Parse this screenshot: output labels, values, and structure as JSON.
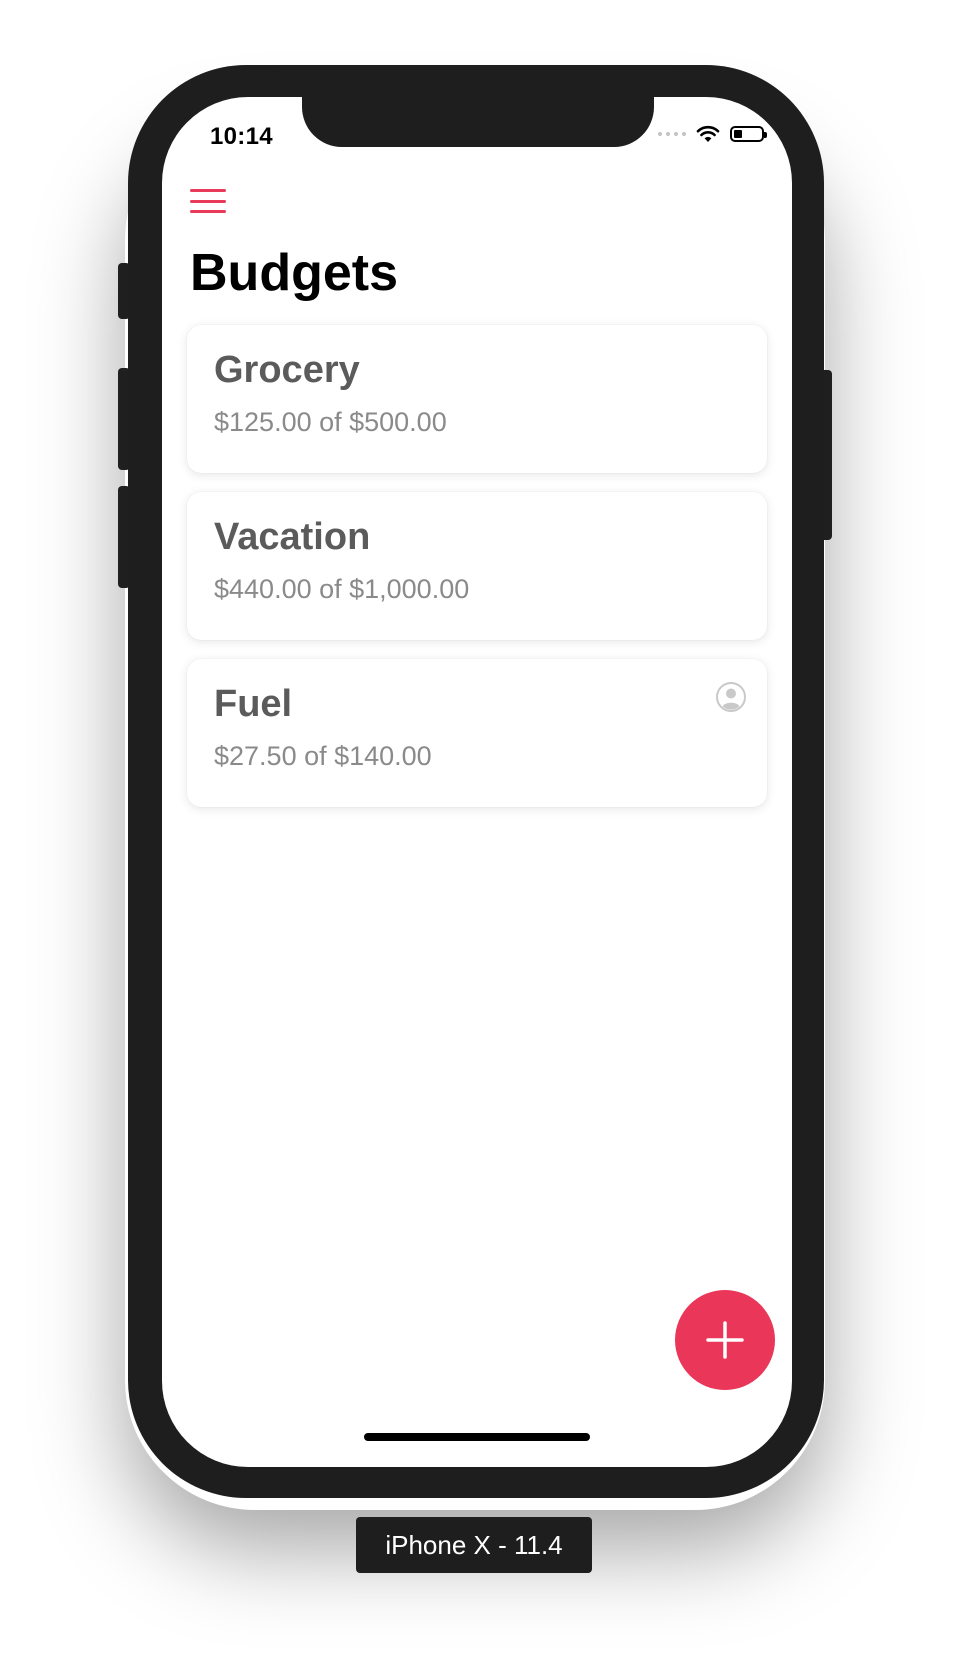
{
  "status_bar": {
    "time": "10:14"
  },
  "header": {
    "title": "Budgets"
  },
  "budgets": [
    {
      "name": "Grocery",
      "amount": "$125.00 of $500.00",
      "shared": false
    },
    {
      "name": "Vacation",
      "amount": "$440.00 of $1,000.00",
      "shared": false
    },
    {
      "name": "Fuel",
      "amount": "$27.50 of $140.00",
      "shared": true
    }
  ],
  "device_label": "iPhone X - 11.4",
  "colors": {
    "accent": "#ea3658",
    "card_title": "#5b5b5b",
    "card_subtitle": "#8a8a8a"
  },
  "icons": {
    "menu": "hamburger-menu-icon",
    "shared": "person-circle-icon",
    "add": "plus-icon",
    "wifi": "wifi-icon",
    "battery": "battery-icon",
    "signal": "signal-icon"
  }
}
